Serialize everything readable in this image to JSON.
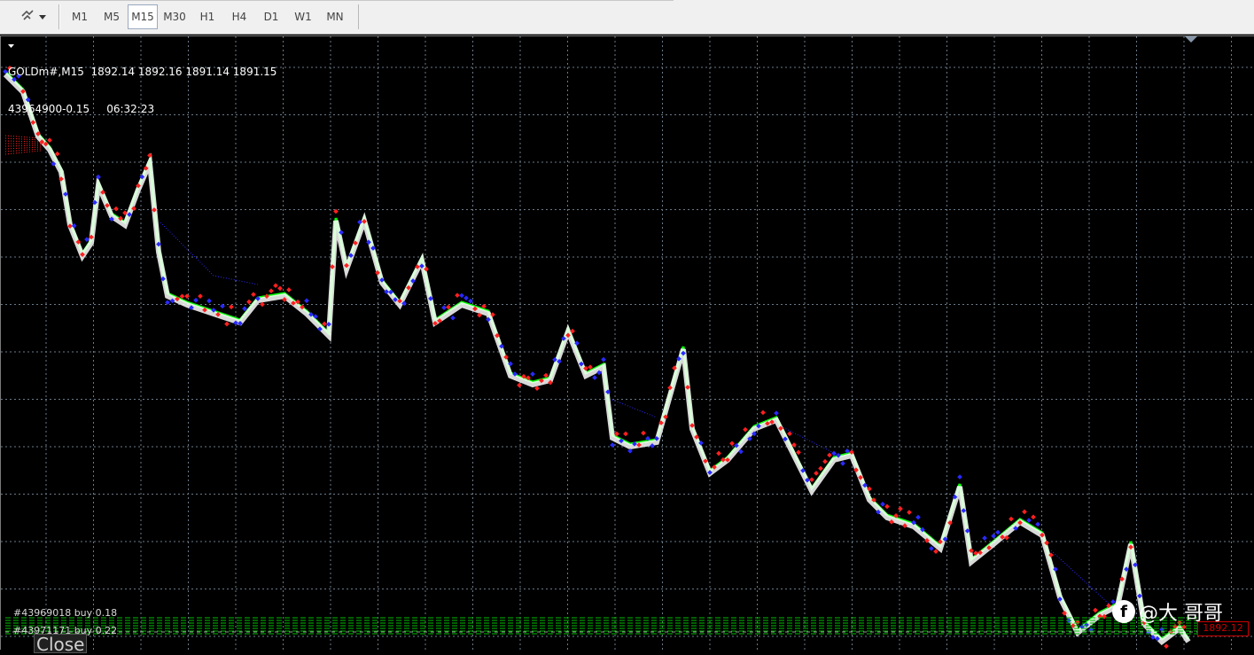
{
  "toolbar": {
    "timeframes": [
      "M1",
      "M5",
      "M15",
      "M30",
      "H1",
      "H4",
      "D1",
      "W1",
      "MN"
    ],
    "active_timeframe": "M15",
    "tool_icon": "drawing-tools-icon"
  },
  "chart": {
    "symbol_line": "GOLDm#,M15  1892.14 1892.16 1891.14 1891.15",
    "info_line": "43964900-0.15     06:32:23",
    "current_price": "1892.12",
    "order_labels": [
      "#43969018 buy 0.18",
      "#43971171 buy 0.22"
    ],
    "close_button_label": "Close",
    "colors": {
      "background": "#000000",
      "grid": "#6a7a88",
      "buy_marker": "#2a2aff",
      "sell_marker": "#ff2020",
      "rising_line": "#00ff00",
      "level_lines": "#00c000"
    }
  },
  "watermark": {
    "text": "@大 哥哥",
    "icon": "facebook-icon"
  }
}
